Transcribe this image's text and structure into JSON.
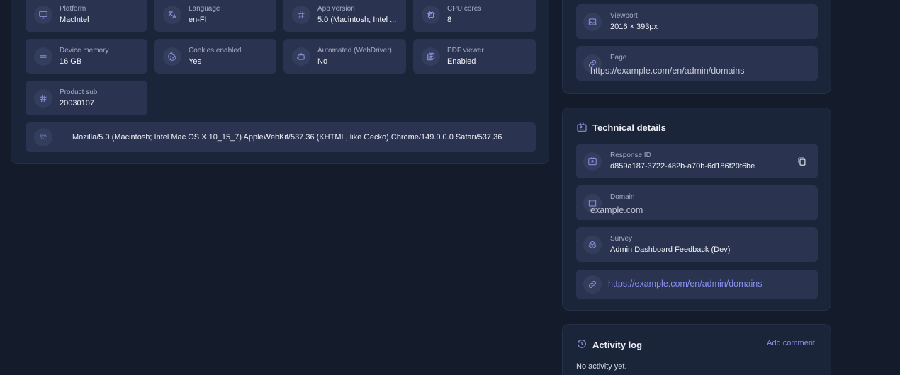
{
  "device": {
    "tiles": [
      {
        "label": "Platform",
        "value": "MacIntel",
        "icon": "monitor-icon"
      },
      {
        "label": "Language",
        "value": "en-FI",
        "icon": "translate-icon"
      },
      {
        "label": "App version",
        "value": "5.0 (Macintosh; Intel ...",
        "icon": "hash-icon"
      },
      {
        "label": "CPU cores",
        "value": "8",
        "icon": "cpu-icon"
      },
      {
        "label": "Device memory",
        "value": "16 GB",
        "icon": "memory-icon"
      },
      {
        "label": "Cookies enabled",
        "value": "Yes",
        "icon": "cookie-icon"
      },
      {
        "label": "Automated (WebDriver)",
        "value": "No",
        "icon": "robot-icon"
      },
      {
        "label": "PDF viewer",
        "value": "Enabled",
        "icon": "pdf-icon"
      },
      {
        "label": "Product sub",
        "value": "20030107",
        "icon": "hash-icon"
      }
    ],
    "user_agent": "Mozilla/5.0 (Macintosh; Intel Mac OS X 10_15_7) AppleWebKit/537.36 (KHTML, like Gecko) Chrome/149.0.0.0 Safari/537.36"
  },
  "viewport_card": {
    "viewport_label": "Viewport",
    "viewport_value": "2016 × 393px",
    "page_label": "Page",
    "page_value": "https://example.com/en/admin/domains"
  },
  "technical": {
    "title": "Technical details",
    "response_id_label": "Response ID",
    "response_id_value": "d859a187-3722-482b-a70b-6d186f20f6be",
    "domain_label": "Domain",
    "domain_value": "example.com",
    "survey_label": "Survey",
    "survey_value": "Admin Dashboard Feedback (Dev)",
    "link": "https://example.com/en/admin/domains"
  },
  "activity": {
    "title": "Activity log",
    "add_comment": "Add comment",
    "empty": "No activity yet."
  },
  "colors": {
    "background": "#141c2b",
    "card": "#1b2539",
    "tile": "#2a3350",
    "accent": "#8a8ff0"
  }
}
